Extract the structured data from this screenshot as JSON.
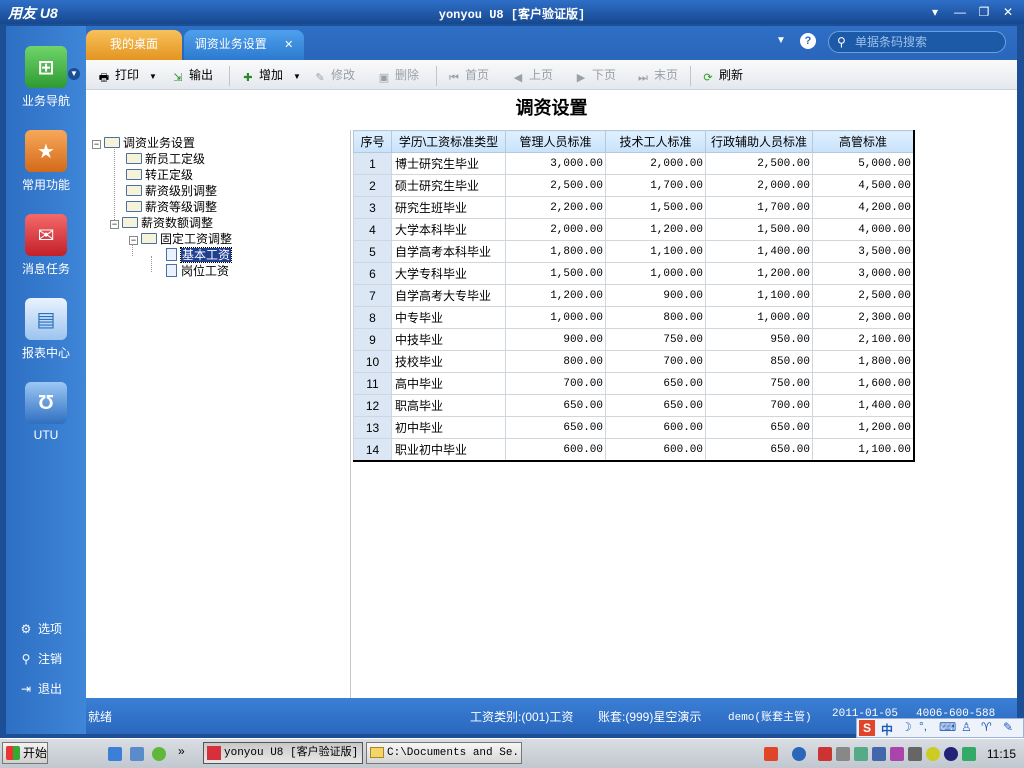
{
  "window": {
    "logo": "用友 U8",
    "title": "yonyou U8 [客户验证版]",
    "controls": [
      "▾",
      "—",
      "❐",
      "✕"
    ]
  },
  "sidebar": {
    "items": [
      {
        "label": "业务导航",
        "icon": "business-nav-icon",
        "color": "#3aa53a"
      },
      {
        "label": "常用功能",
        "icon": "star-icon",
        "color": "#e07020"
      },
      {
        "label": "消息任务",
        "icon": "mail-icon",
        "color": "#d8303a"
      },
      {
        "label": "报表中心",
        "icon": "report-icon",
        "color": "#4a90d8"
      },
      {
        "label": "UTU",
        "icon": "utu-icon",
        "color": "#3a78c8"
      }
    ],
    "bottom": [
      {
        "label": "选项",
        "icon": "gear-icon"
      },
      {
        "label": "注销",
        "icon": "key-icon"
      },
      {
        "label": "退出",
        "icon": "exit-icon"
      }
    ]
  },
  "tabs": [
    {
      "label": "我的桌面"
    },
    {
      "label": "调资业务设置"
    }
  ],
  "search": {
    "placeholder": "单据条码搜索"
  },
  "toolbar": {
    "print": "打印",
    "export": "输出",
    "add": "增加",
    "edit": "修改",
    "delete": "删除",
    "first": "首页",
    "prev": "上页",
    "next": "下页",
    "last": "末页",
    "refresh": "刷新"
  },
  "page_title": "调资设置",
  "tree": [
    {
      "label": "调资业务设置"
    },
    {
      "label": "新员工定级"
    },
    {
      "label": "转正定级"
    },
    {
      "label": "薪资级别调整"
    },
    {
      "label": "薪资等级调整"
    },
    {
      "label": "薪资数额调整"
    },
    {
      "label": "固定工资调整"
    },
    {
      "label": "基本工资"
    },
    {
      "label": "岗位工资"
    }
  ],
  "grid": {
    "headers": [
      "序号",
      "学历\\工资标准类型",
      "管理人员标准",
      "技术工人标准",
      "行政辅助人员标准",
      "高管标准"
    ],
    "rows": [
      [
        "1",
        "博士研究生毕业",
        "3,000.00",
        "2,000.00",
        "2,500.00",
        "5,000.00"
      ],
      [
        "2",
        "硕士研究生毕业",
        "2,500.00",
        "1,700.00",
        "2,000.00",
        "4,500.00"
      ],
      [
        "3",
        "研究生班毕业",
        "2,200.00",
        "1,500.00",
        "1,700.00",
        "4,200.00"
      ],
      [
        "4",
        "大学本科毕业",
        "2,000.00",
        "1,200.00",
        "1,500.00",
        "4,000.00"
      ],
      [
        "5",
        "自学高考本科毕业",
        "1,800.00",
        "1,100.00",
        "1,400.00",
        "3,500.00"
      ],
      [
        "6",
        "大学专科毕业",
        "1,500.00",
        "1,000.00",
        "1,200.00",
        "3,000.00"
      ],
      [
        "7",
        "自学高考大专毕业",
        "1,200.00",
        "900.00",
        "1,100.00",
        "2,500.00"
      ],
      [
        "8",
        "中专毕业",
        "1,000.00",
        "800.00",
        "1,000.00",
        "2,300.00"
      ],
      [
        "9",
        "中技毕业",
        "900.00",
        "750.00",
        "950.00",
        "2,100.00"
      ],
      [
        "10",
        "技校毕业",
        "800.00",
        "700.00",
        "850.00",
        "1,800.00"
      ],
      [
        "11",
        "高中毕业",
        "700.00",
        "650.00",
        "750.00",
        "1,600.00"
      ],
      [
        "12",
        "职高毕业",
        "650.00",
        "650.00",
        "700.00",
        "1,400.00"
      ],
      [
        "13",
        "初中毕业",
        "650.00",
        "600.00",
        "650.00",
        "1,200.00"
      ],
      [
        "14",
        "职业初中毕业",
        "600.00",
        "600.00",
        "650.00",
        "1,100.00"
      ]
    ]
  },
  "status": {
    "ready": "就绪",
    "wage_type": "工资类别:(001)工资",
    "account": "账套:(999)星空演示",
    "user": "demo(账套主管)",
    "date": "2011-01-05",
    "phone": "4006-600-588"
  },
  "ime": {
    "label": "中"
  },
  "taskbar": {
    "start": "开始",
    "tasks": [
      "yonyou U8 [客户验证版]",
      "C:\\Documents and Se..."
    ],
    "clock": "11:15"
  }
}
